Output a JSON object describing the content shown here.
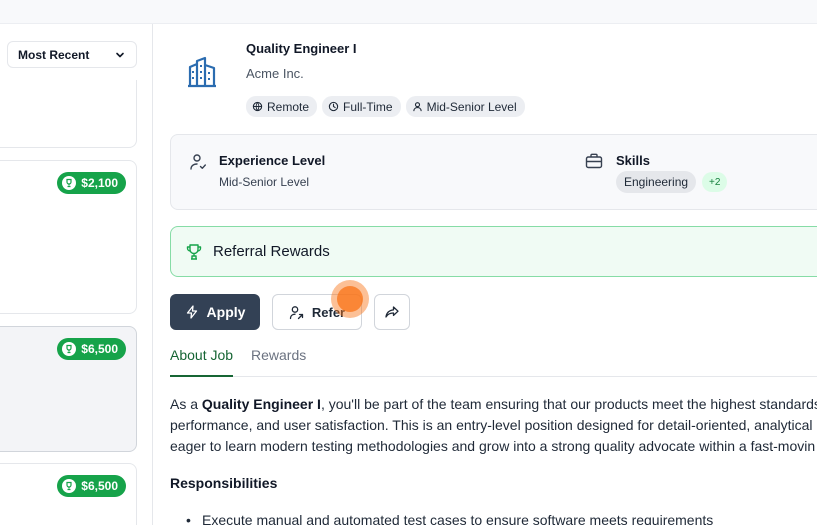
{
  "sidebar": {
    "sort": {
      "label": "Most Recent"
    },
    "cards": [
      {
        "reward": ""
      },
      {
        "reward": "$2,100"
      },
      {
        "reward": "$6,500",
        "selected": true
      },
      {
        "reward": "$6,500"
      }
    ]
  },
  "job": {
    "title": "Quality Engineer I",
    "company": "Acme Inc.",
    "tags": [
      "Remote",
      "Full-Time",
      "Mid-Senior Level"
    ]
  },
  "info": {
    "experience_label": "Experience Level",
    "experience_value": "Mid-Senior Level",
    "skills_label": "Skills",
    "skills": [
      "Engineering"
    ],
    "skills_more": "+2"
  },
  "referral": {
    "title": "Referral Rewards"
  },
  "actions": {
    "apply": "Apply",
    "refer": "Refer"
  },
  "tabs": [
    "About Job",
    "Rewards"
  ],
  "description": {
    "intro": "As a ",
    "role": "Quality Engineer I",
    "line1_rest": ", you'll be part of the team ensuring that our products meet the highest standards",
    "line2": "performance, and user satisfaction. This is an entry-level position designed for detail-oriented, analytical",
    "line3": "eager to learn modern testing methodologies and grow into a strong quality advocate within a fast-movin"
  },
  "responsibilities": {
    "heading": "Responsibilities",
    "items": [
      "Execute manual and automated test cases to ensure software meets requirements"
    ]
  },
  "colors": {
    "accent_green": "#16a34a",
    "primary_dark": "#334155",
    "cursor": "#f97316"
  }
}
